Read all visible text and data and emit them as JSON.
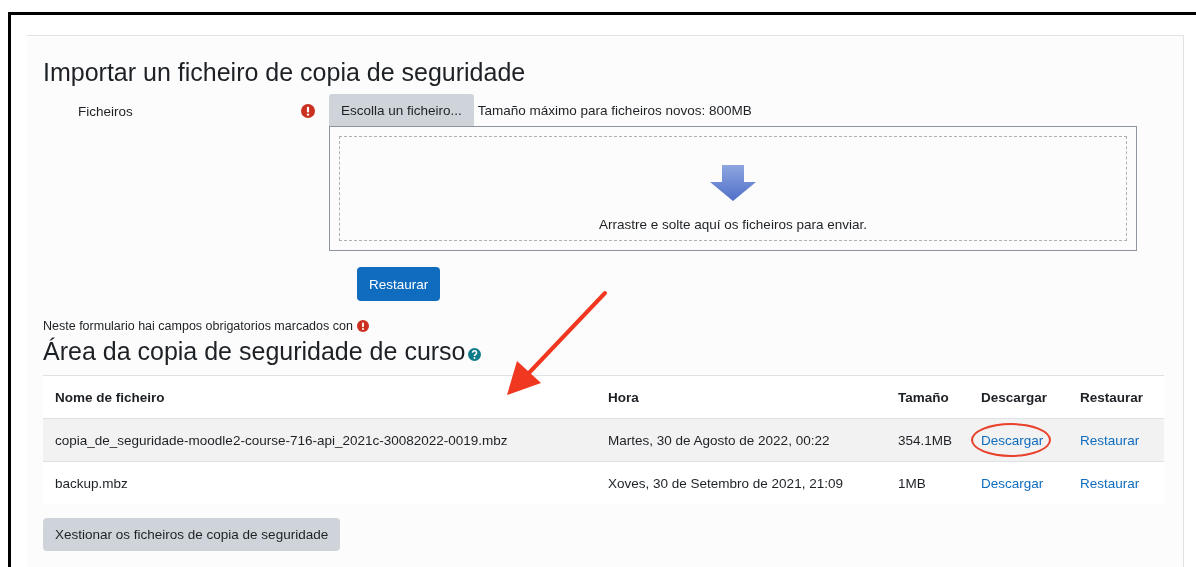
{
  "import_section": {
    "title": "Importar un ficheiro de copia de seguridade",
    "files_field": {
      "label": "Ficheiros",
      "choose_button": "Escolla un ficheiro...",
      "max_size": "Tamaño máximo para ficheiros novos: 800MB",
      "drop_hint": "Arrastre e solte aquí os ficheiros para enviar."
    },
    "restore_button": "Restaurar",
    "required_note": "Neste formulario hai campos obrigatorios marcados con"
  },
  "course_backup_area": {
    "title": "Área da copia de seguridade de curso",
    "table": {
      "columns": [
        "Nome de ficheiro",
        "Hora",
        "Tamaño",
        "Descargar",
        "Restaurar"
      ],
      "rows": [
        {
          "filename": "copia_de_seguridade-moodle2-course-716-api_2021c-30082022-0019.mbz",
          "time": "Martes, 30 de Agosto de 2022, 00:22",
          "size": "354.1MB",
          "download": "Descargar",
          "restore": "Restaurar",
          "highlighted": true
        },
        {
          "filename": "backup.mbz",
          "time": "Xoves, 30 de Setembro de 2021, 21:09",
          "size": "1MB",
          "download": "Descargar",
          "restore": "Restaurar",
          "highlighted": false
        }
      ]
    },
    "manage_button": "Xestionar os ficheiros de copia de seguridade"
  }
}
